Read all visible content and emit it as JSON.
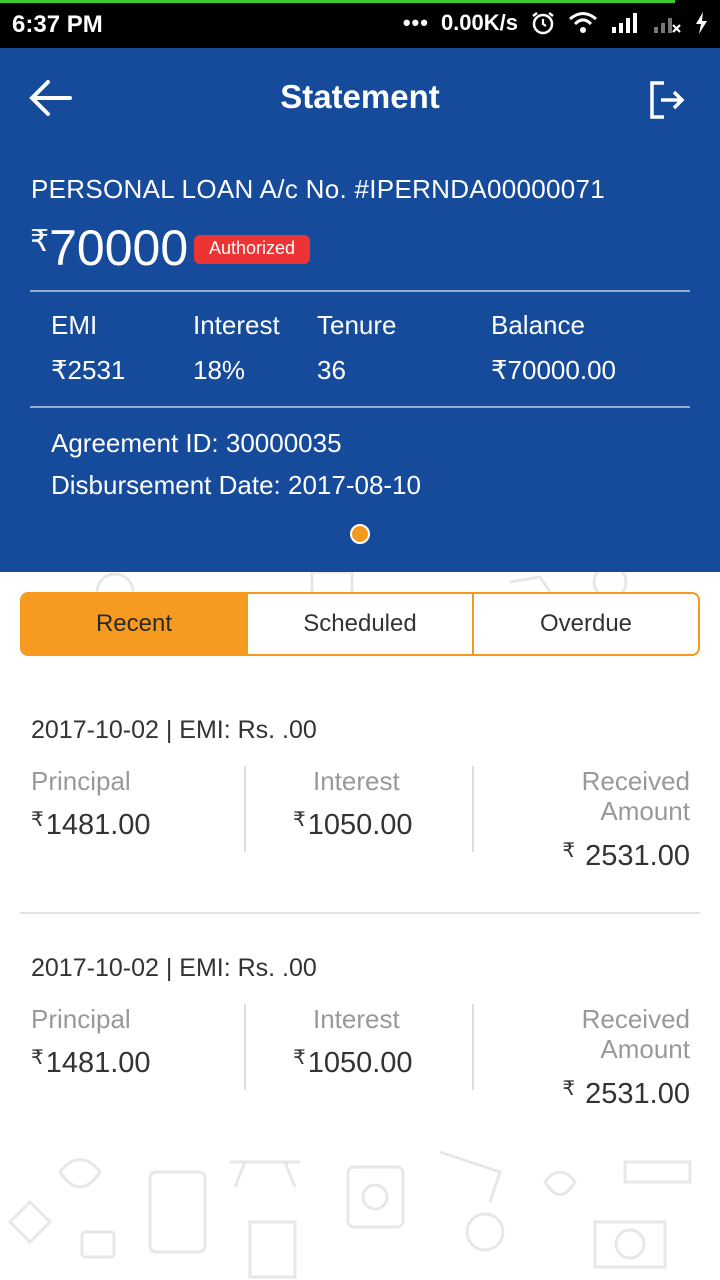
{
  "status_bar": {
    "time": "6:37 PM",
    "net_speed": "0.00K/s"
  },
  "header": {
    "title": "Statement"
  },
  "loan": {
    "account_label": "PERSONAL LOAN A/c No. #IPERNDA00000071",
    "currency_symbol": "₹",
    "amount": "70000",
    "status_badge": "Authorized",
    "stats": [
      {
        "label": "EMI",
        "value": "₹2531"
      },
      {
        "label": "Interest",
        "value": "18%"
      },
      {
        "label": "Tenure",
        "value": "36"
      },
      {
        "label": "Balance",
        "value": "₹70000.00"
      }
    ],
    "agreement_id": "Agreement ID: 30000035",
    "disbursement_date": "Disbursement Date: 2017-08-10"
  },
  "tabs": [
    {
      "label": "Recent",
      "active": true
    },
    {
      "label": "Scheduled",
      "active": false
    },
    {
      "label": "Overdue",
      "active": false
    }
  ],
  "statements": [
    {
      "header": "2017-10-02 | EMI: Rs. .00",
      "principal_label": "Principal",
      "principal": "1481.00",
      "interest_label": "Interest",
      "interest": "1050.00",
      "received_label_1": "Received",
      "received_label_2": "Amount",
      "received": "2531.00"
    },
    {
      "header": "2017-10-02 | EMI: Rs. .00",
      "principal_label": "Principal",
      "principal": "1481.00",
      "interest_label": "Interest",
      "interest": "1050.00",
      "received_label_1": "Received",
      "received_label_2": "Amount",
      "received": "2531.00"
    }
  ],
  "colors": {
    "header_bg": "#164a9a",
    "accent": "#f79a20",
    "badge": "#ec3434"
  }
}
